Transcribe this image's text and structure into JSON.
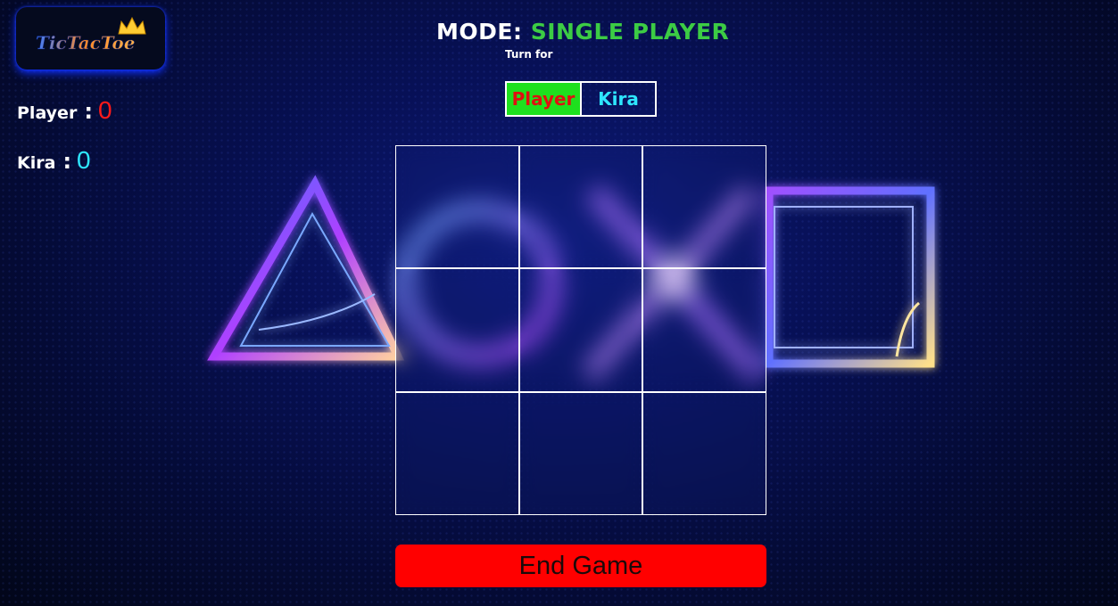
{
  "logo": {
    "text": "TicTacToe"
  },
  "scores": [
    {
      "name": "Player",
      "value": "0",
      "color": "#ff1a1a"
    },
    {
      "name": "Kira",
      "value": "0",
      "color": "#2ee6ff"
    }
  ],
  "mode": {
    "label": "MODE:",
    "value": "SINGLE PLAYER",
    "value_color": "#3ccc44"
  },
  "turn": {
    "label": "Turn for",
    "options": [
      "Player",
      "Kira"
    ],
    "active": "Player",
    "active_bg": "#1ee01e"
  },
  "board": {
    "cells": [
      "",
      "",
      "",
      "",
      "",
      "",
      "",
      "",
      ""
    ]
  },
  "end_button": {
    "label": "End Game",
    "color": "#ff0000"
  },
  "background_shapes": [
    "triangle-icon",
    "circle-icon",
    "cross-icon",
    "square-icon"
  ]
}
